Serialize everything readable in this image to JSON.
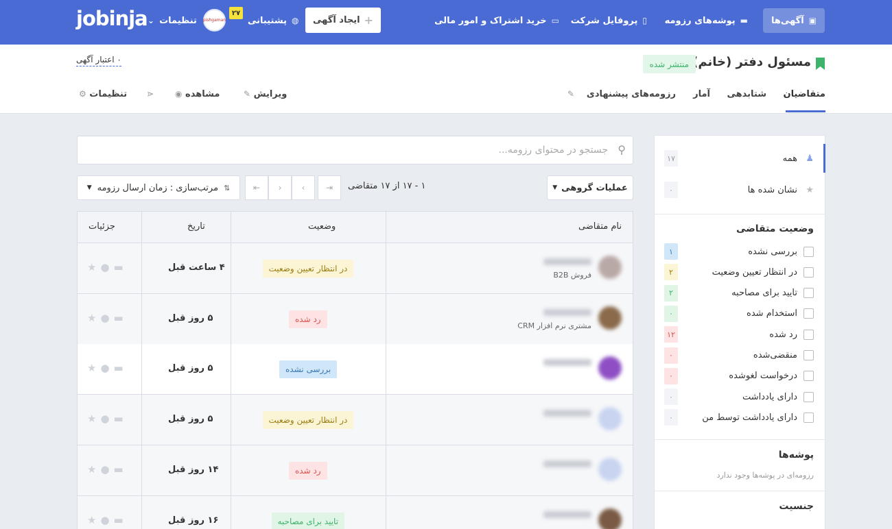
{
  "nav": {
    "ads": "آگهی‌ها",
    "resume_folders": "پوشه‌های رزومه",
    "company_profile": "پروفایل شرکت",
    "subscription": "خرید اشتراک و امور مالی",
    "create_ad": "ایجاد آگهی",
    "support": "پشتیبانی",
    "support_badge": "۲۷",
    "settings": "تنظیمات",
    "logo": "jobinja",
    "avatar_text": "pishgaman"
  },
  "job": {
    "title": "مسئول دفتر (خانم)",
    "status": "منتشر شده",
    "credit": "۰ اعتبار آگهی"
  },
  "tabs": {
    "applicants": "متقاضیان",
    "shortlist": "شتابدهی",
    "stats": "آمار",
    "suggested": "رزومه‌های پیشنهادی",
    "edit": "ویرایش",
    "view": "مشاهده",
    "settings": "تنظیمات"
  },
  "sidebar": {
    "all": {
      "label": "همه",
      "count": "۱۷"
    },
    "starred": {
      "label": "نشان شده ها",
      "count": "۰"
    },
    "status_heading": "وضعیت متقاضی",
    "statuses": [
      {
        "label": "بررسی نشده",
        "count": "۱",
        "color": "#3a78b5",
        "bg": "#cfe7f9"
      },
      {
        "label": "در انتظار تعیین وضعیت",
        "count": "۲",
        "color": "#9a7d12",
        "bg": "#fbf5d6"
      },
      {
        "label": "تایید برای مصاحبه",
        "count": "۲",
        "color": "#3db36b",
        "bg": "#e1f5e7"
      },
      {
        "label": "استخدام شده",
        "count": "۰",
        "color": "#3db36b",
        "bg": "#e1f5e7"
      },
      {
        "label": "رد شده",
        "count": "۱۲",
        "color": "#d9534f",
        "bg": "#fde3e3"
      },
      {
        "label": "منقضی‌شده",
        "count": "۰",
        "color": "#d9534f",
        "bg": "#fde3e3"
      },
      {
        "label": "درخواست لغوشده",
        "count": "۰",
        "color": "#d9534f",
        "bg": "#fde3e3"
      },
      {
        "label": "دارای یادداشت",
        "count": "۰",
        "color": "#999999",
        "bg": "#f3f4f7"
      },
      {
        "label": "دارای یادداشت توسط من",
        "count": "۰",
        "color": "#999999",
        "bg": "#f3f4f7"
      }
    ],
    "folders_heading": "پوشه‌ها",
    "folders_empty": "رزومه‌ای در پوشه‌ها وجود ندارد",
    "gender_heading": "جنسیت"
  },
  "search": {
    "placeholder": "جستجو در محتوای رزومه..."
  },
  "toolbar": {
    "bulk_actions": "عملیات گروهی",
    "pagination": "۱ - ۱۷ از ۱۷ متقاضی",
    "sort": "مرتب‌سازی : زمان ارسال رزومه"
  },
  "table": {
    "headers": {
      "name": "نام متقاضی",
      "status": "وضعیت",
      "date": "تاریخ",
      "details": "جزئیات"
    },
    "rows": [
      {
        "subtitle": "فروش B2B",
        "status": "در انتظار تعیین وضعیت",
        "status_type": "pending",
        "date": "۴ ساعت قبل",
        "photo": "#b9a9a6",
        "highlight": false
      },
      {
        "subtitle": "مشتری نرم افزار CRM",
        "status": "رد شده",
        "status_type": "rejected",
        "date": "۵ روز قبل",
        "photo": "#8a6a4a",
        "highlight": false
      },
      {
        "subtitle": "",
        "status": "بررسی نشده",
        "status_type": "unreviewed",
        "date": "۵ روز قبل",
        "photo": "#8e4fc4",
        "highlight": true
      },
      {
        "subtitle": "",
        "status": "در انتظار تعیین وضعیت",
        "status_type": "pending",
        "date": "۵ روز قبل",
        "photo": "#c8d4f0",
        "highlight": false
      },
      {
        "subtitle": "",
        "status": "رد شده",
        "status_type": "rejected",
        "date": "۱۴ روز قبل",
        "photo": "#c8d4f0",
        "highlight": false
      },
      {
        "subtitle": "",
        "status": "تایید برای مصاحبه",
        "status_type": "approved",
        "date": "۱۶ روز قبل",
        "photo": "#7a5a44",
        "highlight": false
      }
    ]
  }
}
